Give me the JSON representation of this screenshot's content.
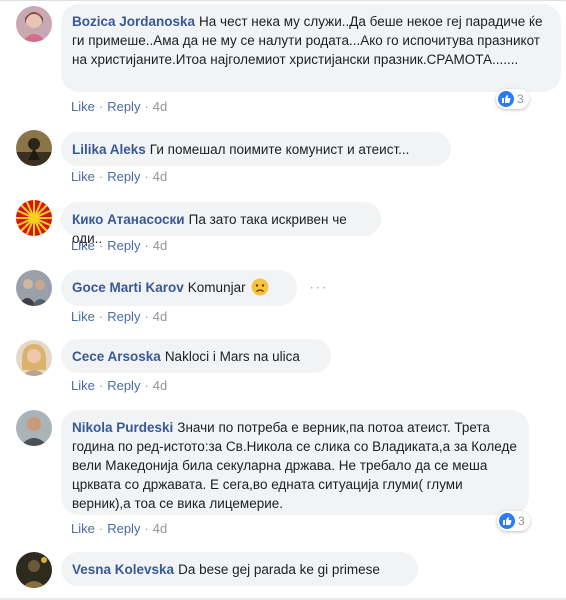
{
  "colors": {
    "author": "#385898",
    "action": "#4b6aa6",
    "bubble": "#f2f3f5",
    "like": "#2b7cf7"
  },
  "action_labels": {
    "like": "Like",
    "reply": "Reply",
    "sep": "·"
  },
  "comments": [
    {
      "author": "Bozica Jordanoska",
      "text": "На чест нека му служи..Да беше некое геј парадиче ќе ги примеше..Ама да не му се налути родата...Ако го испочитува празникот на христијаните.Итоа најголемиот христијански празник.СРАМОТА.......",
      "time": "4d",
      "reactions": "3",
      "avatar": "avatar-woman-photo"
    },
    {
      "author": "Lilika Aleks",
      "text": "Ги помешал поимите комунист и атеист...",
      "time": "4d",
      "avatar": "avatar-dark-photo"
    },
    {
      "author": "Кико Атанасоски",
      "text": "Па зато така искривен че оди..",
      "time": "4d",
      "avatar": "avatar-vergina-sun"
    },
    {
      "author": "Goce Marti Karov",
      "text": "Komunjar",
      "emoji": "sad-face-icon",
      "time": "4d",
      "avatar": "avatar-man-photo"
    },
    {
      "author": "Cece Arsoska",
      "text": "Nakloci i Mars na ulica",
      "time": "4d",
      "avatar": "avatar-blonde-photo"
    },
    {
      "author": "Nikola Purdeski",
      "text": "Значи по потреба е верник,па потоа атеист. Трета година по ред-истото:за Св.Никола се слика со Владиката,а за Коледе вели Македонија била секуларна држава. Не требало да се меша црквата со државата. Е сега,во едната ситуација глуми( глуми верник),а тоа се вика лицемерие.",
      "time": "4d",
      "reactions": "3",
      "avatar": "avatar-man-photo-2"
    },
    {
      "author": "Vesna Kolevska",
      "text": "Da bese gej parada ke gi primese",
      "avatar": "avatar-dark-photo-2"
    }
  ]
}
